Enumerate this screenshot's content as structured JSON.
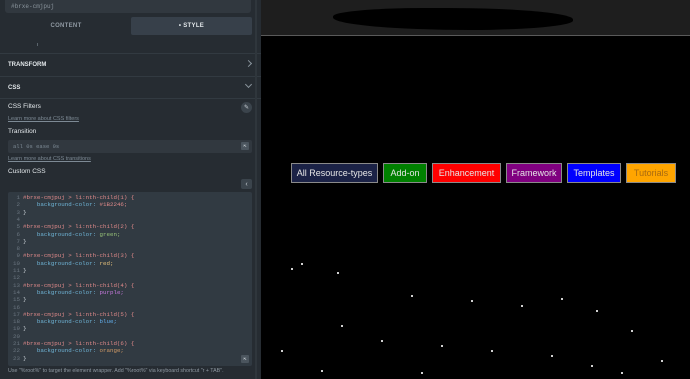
{
  "panel": {
    "element_id": "#brxe-cmjpuj",
    "tabs": [
      {
        "label": "CONTENT"
      },
      {
        "label": "• STYLE"
      }
    ],
    "sections": {
      "transform": "TRANSFORM",
      "css": "CSS"
    },
    "css_filters_label": "CSS Filters",
    "css_filters_link": "Learn more about CSS filters",
    "transition_label": "Transition",
    "transition_placeholder": "all 0s ease 0s",
    "transition_link": "Learn more about CSS transitions",
    "custom_css_label": "Custom CSS",
    "code_lines": [
      {
        "n": "1",
        "sel": "#brxe-cmjpuj > li:nth-child(1) {"
      },
      {
        "n": "2",
        "prop": "    background-color: ",
        "val": "#1B2246;",
        "cls": "val-c"
      },
      {
        "n": "3",
        "brace": "}"
      },
      {
        "n": "4",
        "brace": ""
      },
      {
        "n": "5",
        "sel": "#brxe-cmjpuj > li:nth-child(2) {"
      },
      {
        "n": "6",
        "prop": "    background-color: ",
        "val": "green;",
        "cls": "val-g"
      },
      {
        "n": "7",
        "brace": "}"
      },
      {
        "n": "8",
        "brace": ""
      },
      {
        "n": "9",
        "sel": "#brxe-cmjpuj > li:nth-child(3) {"
      },
      {
        "n": "10",
        "prop": "    background-color: ",
        "val": "red;",
        "cls": "val-r"
      },
      {
        "n": "11",
        "brace": "}"
      },
      {
        "n": "12",
        "brace": ""
      },
      {
        "n": "13",
        "sel": "#brxe-cmjpuj > li:nth-child(4) {"
      },
      {
        "n": "14",
        "prop": "    background-color: ",
        "val": "purple;",
        "cls": "val-p"
      },
      {
        "n": "15",
        "brace": "}"
      },
      {
        "n": "16",
        "brace": ""
      },
      {
        "n": "17",
        "sel": "#brxe-cmjpuj > li:nth-child(5) {"
      },
      {
        "n": "18",
        "prop": "    background-color: ",
        "val": "blue;",
        "cls": "val-b"
      },
      {
        "n": "19",
        "brace": "}"
      },
      {
        "n": "20",
        "brace": ""
      },
      {
        "n": "21",
        "sel": "#brxe-cmjpuj > li:nth-child(6) {"
      },
      {
        "n": "22",
        "prop": "    background-color: ",
        "val": "orange;",
        "cls": "val-o"
      },
      {
        "n": "23",
        "brace": "}"
      }
    ],
    "hint": "Use \"%root%\" to target the element wrapper. Add \"%root%\" via keyboard shortcut \"r + TAB\"."
  },
  "preview": {
    "nav_items": [
      {
        "label": "All Resource-types",
        "bg": "#1B2246",
        "color": "#e6e6e6"
      },
      {
        "label": "Add-on",
        "bg": "#008000",
        "color": "#e6e6e6"
      },
      {
        "label": "Enhancement",
        "bg": "#ff0000",
        "color": "#e6e6e6"
      },
      {
        "label": "Framework",
        "bg": "#800080",
        "color": "#e6e6e6"
      },
      {
        "label": "Templates",
        "bg": "#0000ff",
        "color": "#e6e6e6"
      },
      {
        "label": "Tutorials",
        "bg": "#ffa500",
        "color": "#a86a10"
      }
    ]
  },
  "icons": {
    "css_filters_icon": "filter-icon",
    "transition_icon": "expand-icon",
    "collapse_icon": "chevron-left-icon",
    "code_expand_icon": "expand-icon"
  }
}
